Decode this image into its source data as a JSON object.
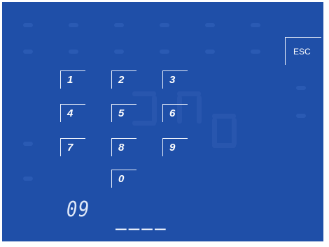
{
  "esc": {
    "label": "ESC"
  },
  "keypad": {
    "keys": [
      "1",
      "2",
      "3",
      "4",
      "5",
      "6",
      "7",
      "8",
      "9",
      "0"
    ]
  },
  "display": {
    "channel": "09",
    "entry": "____"
  }
}
